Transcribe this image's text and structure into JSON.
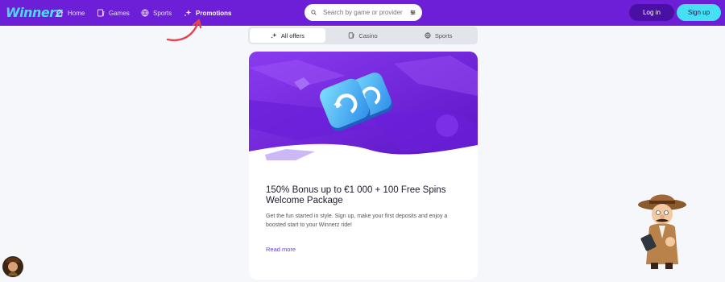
{
  "header": {
    "logo": "Winnerz",
    "nav": [
      {
        "label": "Home",
        "icon": "home-icon"
      },
      {
        "label": "Games",
        "icon": "games-icon"
      },
      {
        "label": "Sports",
        "icon": "sports-ball-icon"
      },
      {
        "label": "Promotions",
        "icon": "sparkle-icon"
      }
    ],
    "search": {
      "placeholder": "Search by game or provider",
      "value": ""
    },
    "login_label": "Log in",
    "signup_label": "Sign up"
  },
  "tabs": [
    {
      "label": "All offers",
      "icon": "sparkle-icon",
      "active": true
    },
    {
      "label": "Casino",
      "icon": "casino-icon",
      "active": false
    },
    {
      "label": "Sports",
      "icon": "sports-ball-icon",
      "active": false
    }
  ],
  "promo": {
    "title": "150% Bonus up to €1 000 + 100 Free Spins Welcome Package",
    "description": "Get the fun started in style. Sign up, make your first deposits and enjoy a boosted start to your Winnerz ride!",
    "link": "Read more"
  },
  "colors": {
    "brand_purple": "#6c1fd6",
    "accent_cyan": "#45e0f5",
    "login_bg": "#4a0fa3",
    "link": "#6a3fd8",
    "annotation_arrow": "#e8454b"
  }
}
